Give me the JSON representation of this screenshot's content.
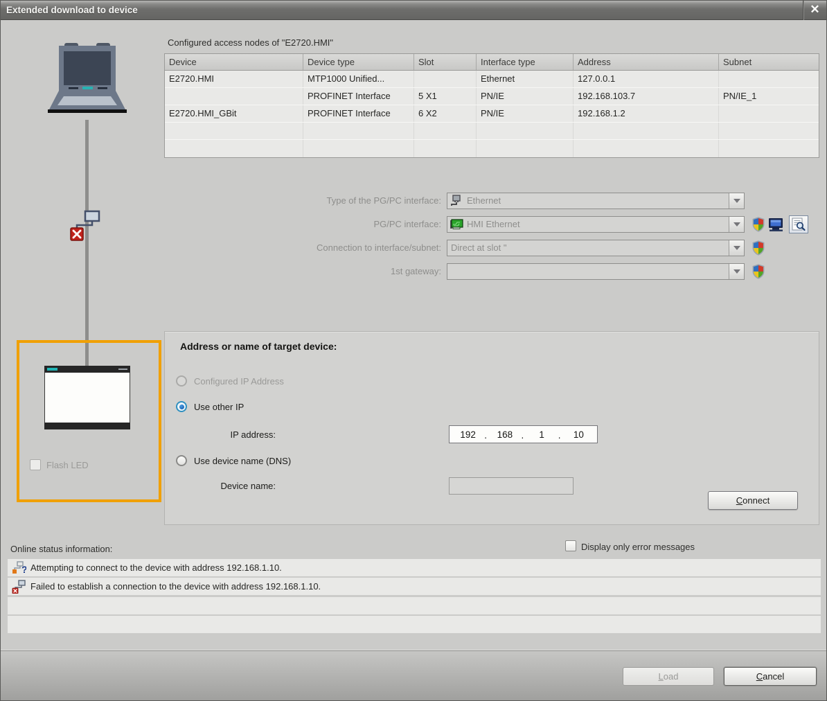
{
  "dialog": {
    "title": "Extended download to device",
    "close_glyph": "✕"
  },
  "access_nodes": {
    "caption": "Configured access nodes of \"E2720.HMI\"",
    "columns": [
      "Device",
      "Device type",
      "Slot",
      "Interface type",
      "Address",
      "Subnet"
    ],
    "rows": [
      [
        "E2720.HMI",
        "MTP1000 Unified...",
        "",
        "Ethernet",
        "127.0.0.1",
        ""
      ],
      [
        "",
        "PROFINET Interface",
        "5 X1",
        "PN/IE",
        "192.168.103.7",
        "PN/IE_1"
      ],
      [
        "E2720.HMI_GBit",
        "PROFINET Interface",
        "6 X2",
        "PN/IE",
        "192.168.1.2",
        ""
      ],
      [
        "",
        "",
        "",
        "",
        "",
        ""
      ],
      [
        "",
        "",
        "",
        "",
        "",
        ""
      ]
    ]
  },
  "pg_interface": {
    "type_label": "Type of the PG/PC interface:",
    "type_value": "Ethernet",
    "interface_label": "PG/PC interface:",
    "interface_value": "HMI Ethernet",
    "connection_label": "Connection to interface/subnet:",
    "connection_value": "Direct at slot \"",
    "gateway_label": "1st gateway:",
    "gateway_value": ""
  },
  "target": {
    "heading": "Address or name of target device:",
    "configured_ip_label": "Configured IP Address",
    "use_other_ip_label": "Use other IP",
    "ip_label": "IP address:",
    "ip_segments": [
      "192",
      "168",
      "1",
      "10"
    ],
    "dns_label": "Use device name (DNS)",
    "device_name_label": "Device name:",
    "device_name_value": "",
    "connect_label": "Connect"
  },
  "device_view": {
    "flash_led_label": "Flash LED"
  },
  "online_status": {
    "label": "Online status information:",
    "filter_label": "Display only error messages",
    "messages": [
      "Attempting to connect to the device with address 192.168.1.10.",
      "Failed to establish a connection to the device with address 192.168.1.10."
    ]
  },
  "footer": {
    "load_label": "Load",
    "cancel_label": "Cancel"
  },
  "colors": {
    "highlight_orange": "#F0A000",
    "accent_teal": "#21B5B5",
    "error_red": "#C0231C",
    "radio_blue": "#1464B4",
    "titlebar_gray": "#6E6E6C"
  }
}
